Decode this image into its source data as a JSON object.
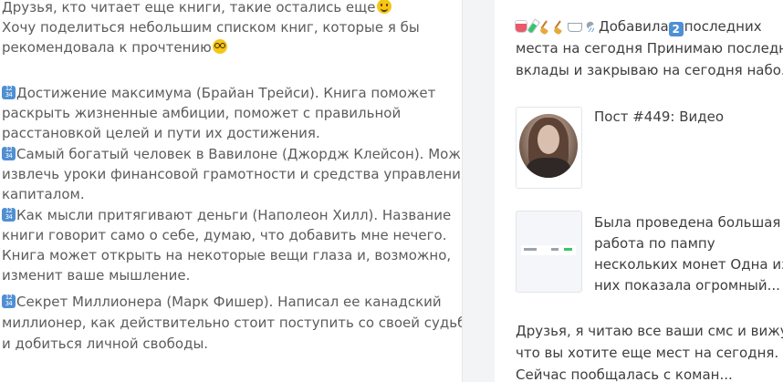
{
  "post": {
    "line1_text": "Друзья, кто читает еще книги, такие остались еще",
    "line1_emoji": "smiling-face",
    "line2": "Хочу поделиться небольшим списком книг, которые я бы",
    "line3_text": "рекомендовала к прочтению",
    "line3_emoji": "nerd-face",
    "books": [
      {
        "number_icon": "keycap-numbers",
        "lines": [
          "Достижение максимума (Брайан Трейси). Книга поможет",
          "раскрыть жизненные амбиции, поможет с правильной",
          "расстановкой целей и пути их достижения."
        ]
      },
      {
        "number_icon": "keycap-numbers",
        "lines": [
          "Самый богатый человек в Вавилоне (Джордж Клейсон). Можно",
          "извлечь уроки финансовой грамотности и средства управления",
          "капиталом."
        ]
      },
      {
        "number_icon": "keycap-numbers",
        "lines": [
          "Как мысли притягивают деньги (Наполеон Хилл). Название",
          "книги говорит само о себе, думаю, что добавить мне нечего.",
          "Книга может открыть на некоторые вещи глаза и, возможно,",
          "изменит ваше мышление."
        ]
      },
      {
        "number_icon": "keycap-numbers",
        "lines": [
          "Секрет Миллионера (Марк Фишер). Написал ее канадский",
          "миллионер, как действительно стоит поступить со своей судьбой",
          "и добиться личной свободы."
        ]
      }
    ]
  },
  "sidebar": {
    "items": [
      {
        "lines": [
          "Добавила",
          "последних",
          "места на сегодня Принимаю последние",
          "вклады и закрываю на сегодня набо..."
        ],
        "keycap": "2",
        "emojis": [
          "mug-icon",
          "test-tube-icon",
          "broom-icon",
          "broom-icon",
          "bathtub-icon",
          "shower-icon"
        ]
      },
      {
        "thumbnail": "video-avatar",
        "lines": [
          "Пост #449: Видео"
        ]
      },
      {
        "thumbnail": "screenshot",
        "lines": [
          "Была проведена большая",
          "работа по пампу",
          "нескольких монет Одна из",
          "них показала огромный..."
        ]
      },
      {
        "lines": [
          "Друзья, я читаю все ваши смс и вижу,",
          "что вы хотите еще мест на сегодня.",
          "Сейчас пообщалась с коман..."
        ]
      }
    ]
  },
  "colors": {
    "post_text": "#5c5c5c",
    "sidebar_text": "#3e3e3e",
    "keycap_blue": "#4f8fd3",
    "divider_bg": "#f3f4f6"
  }
}
